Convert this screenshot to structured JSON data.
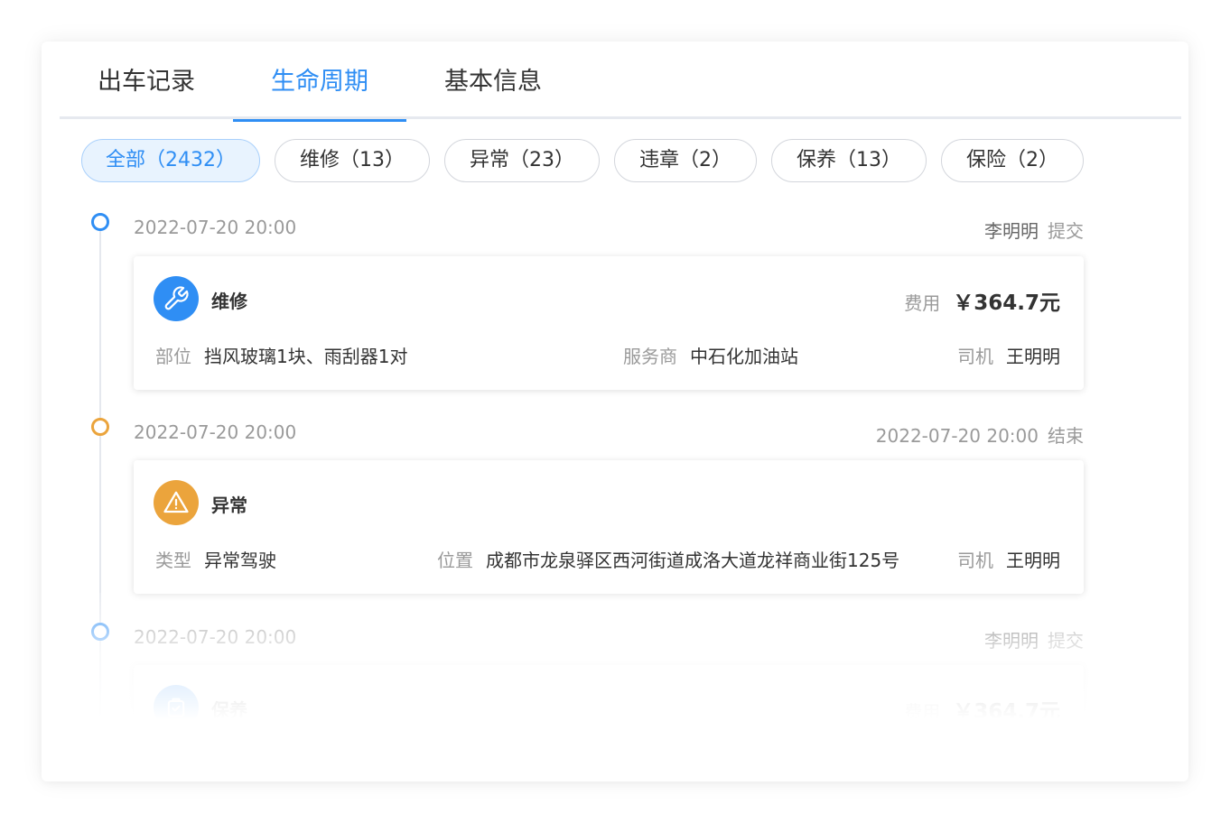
{
  "tabs": [
    {
      "label": "出车记录"
    },
    {
      "label": "生命周期"
    },
    {
      "label": "基本信息"
    }
  ],
  "active_tab": "生命周期",
  "filters": [
    {
      "label": "全部（2432）"
    },
    {
      "label": "维修（13）"
    },
    {
      "label": "异常（23）"
    },
    {
      "label": "违章（2）"
    },
    {
      "label": "保养（13）"
    },
    {
      "label": "保险（2）"
    }
  ],
  "active_filter": "全部（2432）",
  "colors": {
    "accent": "#2f8ef4",
    "warning": "#eba43c"
  },
  "timeline": [
    {
      "time": "2022-07-20 20:00",
      "right_who": "李明明",
      "right_action": "提交",
      "node_color": "blue",
      "icon": "wrench-icon",
      "type": "维修",
      "cost_label": "费用",
      "cost_value": "￥364.7元",
      "fields": [
        {
          "key": "部位",
          "value": "挡风玻璃1块、雨刮器1对"
        },
        {
          "key": "服务商",
          "value": "中石化加油站"
        },
        {
          "key": "司机",
          "value": "王明明"
        }
      ]
    },
    {
      "time": "2022-07-20 20:00",
      "right_who": "2022-07-20 20:00",
      "right_action": "结束",
      "node_color": "orange",
      "icon": "warning-icon",
      "type": "异常",
      "fields": [
        {
          "key": "类型",
          "value": "异常驾驶"
        },
        {
          "key": "位置",
          "value": "成都市龙泉驿区西河街道成洛大道龙祥商业街125号"
        },
        {
          "key": "司机",
          "value": "王明明"
        }
      ]
    },
    {
      "time": "2022-07-20 20:00",
      "right_who": "李明明",
      "right_action": "提交",
      "node_color": "blue",
      "icon": "maintenance-icon",
      "type": "保养",
      "cost_label": "费用",
      "cost_value": "￥364.7元"
    }
  ]
}
